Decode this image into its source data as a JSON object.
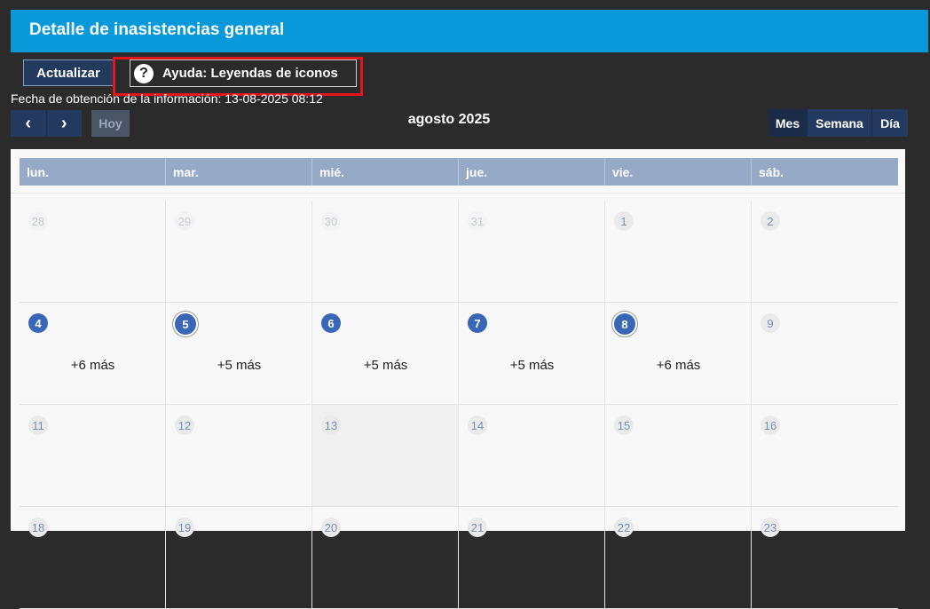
{
  "header": {
    "title": "Detalle de inasistencias general"
  },
  "toolbar": {
    "refresh_label": "Actualizar",
    "help_label": "Ayuda: Leyendas de iconos",
    "help_icon": "question-circle-icon"
  },
  "fetch_info": "Fecha de obtención de la información: 13-08-2025 08:12",
  "nav": {
    "prev": "‹",
    "next": "›",
    "today_label": "Hoy"
  },
  "calendar_title": "agosto 2025",
  "views": {
    "month": "Mes",
    "week": "Semana",
    "day": "Día"
  },
  "weekdays": [
    "lun.",
    "mar.",
    "mié.",
    "jue.",
    "vie.",
    "sáb."
  ],
  "weeks": [
    [
      {
        "num": "28"
      },
      {
        "num": "29"
      },
      {
        "num": "30"
      },
      {
        "num": "31"
      },
      {
        "num": "1"
      },
      {
        "num": "2"
      }
    ],
    [
      {
        "num": "4",
        "more": "+6 más"
      },
      {
        "num": "5",
        "more": "+5 más"
      },
      {
        "num": "6",
        "more": "+5 más"
      },
      {
        "num": "7",
        "more": "+5 más"
      },
      {
        "num": "8",
        "more": "+6 más"
      },
      {
        "num": "9"
      }
    ],
    [
      {
        "num": "11"
      },
      {
        "num": "12"
      },
      {
        "num": "13"
      },
      {
        "num": "14"
      },
      {
        "num": "15"
      },
      {
        "num": "16"
      }
    ],
    [
      {
        "num": "18"
      },
      {
        "num": "19"
      },
      {
        "num": "20"
      },
      {
        "num": "21"
      },
      {
        "num": "22"
      },
      {
        "num": "23"
      }
    ]
  ],
  "colors": {
    "header": "#0799d9",
    "accent": "#3a66b8",
    "alert": "#e0141c",
    "button": "#233a5e"
  }
}
